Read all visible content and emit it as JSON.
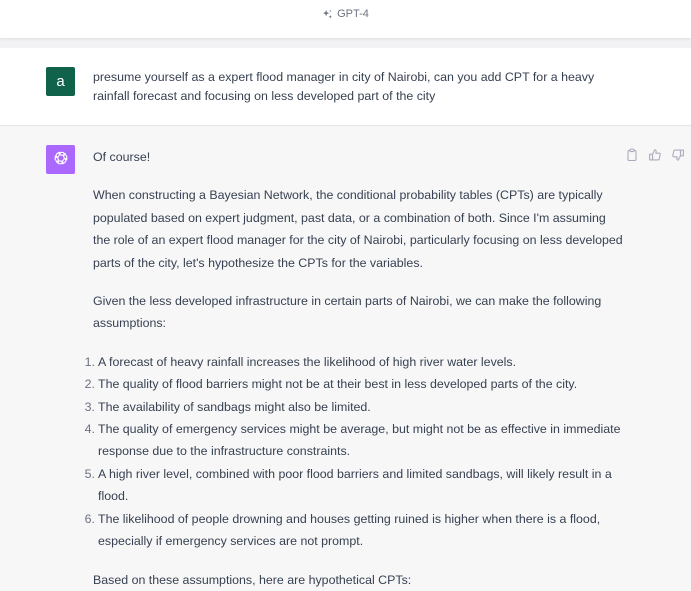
{
  "header": {
    "model_label": "GPT-4",
    "model_icon": "sparkle-icon"
  },
  "user_message": {
    "avatar_letter": "a",
    "text": "presume yourself as a expert flood manager in city of Nairobi, can you add CPT for a heavy rainfall forecast and focusing on less developed part of the city"
  },
  "assistant_message": {
    "avatar_icon": "openai-logo-icon",
    "intro": "Of course!",
    "paragraph1": "When constructing a Bayesian Network, the conditional probability tables (CPTs) are typically populated based on expert judgment, past data, or a combination of both. Since I'm assuming the role of an expert flood manager for the city of Nairobi, particularly focusing on less developed parts of the city, let's hypothesize the CPTs for the variables.",
    "paragraph2": "Given the less developed infrastructure in certain parts of Nairobi, we can make the following assumptions:",
    "list": [
      {
        "num": "1.",
        "text": "A forecast of heavy rainfall increases the likelihood of high river water levels."
      },
      {
        "num": "2.",
        "text": "The quality of flood barriers might not be at their best in less developed parts of the city."
      },
      {
        "num": "3.",
        "text": "The availability of sandbags might also be limited."
      },
      {
        "num": "4.",
        "text": "The quality of emergency services might be average, but might not be as effective in immediate response due to the infrastructure constraints."
      },
      {
        "num": "5.",
        "text": "A high river level, combined with poor flood barriers and limited sandbags, will likely result in a flood."
      },
      {
        "num": "6.",
        "text": "The likelihood of people drowning and houses getting ruined is higher when there is a flood, especially if emergency services are not prompt."
      }
    ],
    "closing": "Based on these assumptions, here are hypothetical CPTs:",
    "actions": [
      "copy-icon",
      "thumbs-up-icon",
      "thumbs-down-icon"
    ]
  },
  "colors": {
    "user_avatar_bg": "#11624a",
    "assistant_avatar_bg": "#ab68ff",
    "assistant_row_bg": "#f7f7f8"
  }
}
